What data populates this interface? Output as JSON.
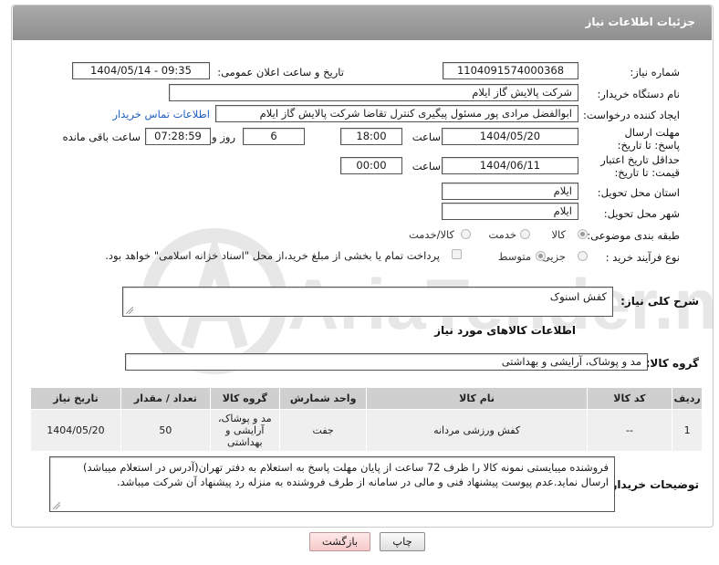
{
  "header": {
    "title": "جزئیات اطلاعات نیاز"
  },
  "fields": {
    "need_number": {
      "label": "شماره نیاز:",
      "value": "1104091574000368"
    },
    "announce": {
      "label": "تاریخ و ساعت اعلان عمومی:",
      "value": "1404/05/14 - 09:35"
    },
    "buyer_org": {
      "label": "نام دستگاه خریدار:",
      "value": "شرکت پالایش گاز ایلام"
    },
    "requester": {
      "label": "ایجاد کننده درخواست:",
      "value": "ابوالفضل مرادی پور مسئول پیگیری کنترل تقاضا شرکت پالایش گاز ایلام",
      "contact_link": "اطلاعات تماس خریدار"
    },
    "deadline": {
      "label": "مهلت ارسال پاسخ: تا تاریخ:",
      "date": "1404/05/20",
      "time_label": "ساعت",
      "time": "18:00",
      "days": "6",
      "days_label": "روز و",
      "remaining": "07:28:59",
      "remaining_label": "ساعت باقی مانده"
    },
    "price_validity": {
      "label": "حداقل تاریخ اعتبار قیمت: تا تاریخ:",
      "date": "1404/06/11",
      "time_label": "ساعت",
      "time": "00:00"
    },
    "province": {
      "label": "استان محل تحویل:",
      "value": "ایلام"
    },
    "city": {
      "label": "شهر محل تحویل:",
      "value": "ایلام"
    },
    "category": {
      "label": "طبقه بندی موضوعی:",
      "options": [
        "کالا",
        "خدمت",
        "کالا/خدمت"
      ],
      "selected": "کالا"
    },
    "process": {
      "label": "نوع فرآیند خرید :",
      "options": [
        "جزیی",
        "متوسط"
      ],
      "selected": "متوسط",
      "note": "پرداخت تمام یا بخشی از مبلغ خرید،از محل \"اسناد خزانه اسلامی\" خواهد بود."
    }
  },
  "description": {
    "label": "شرح کلی نیاز:",
    "value": "کفش اسنوک"
  },
  "goods_section": {
    "title": "اطلاعات کالاهای مورد نیاز"
  },
  "goods_group": {
    "label": "گروه کالا:",
    "value": "مد و پوشاک، آرایشی و بهداشتی"
  },
  "table": {
    "columns": [
      "ردیف",
      "کد کالا",
      "نام کالا",
      "واحد شمارش",
      "گروه کالا",
      "تعداد / مقدار",
      "تاریخ نیاز"
    ],
    "rows": [
      [
        "1",
        "--",
        "کفش ورزشی مردانه",
        "جفت",
        "مد و پوشاک، آرایشی و بهداشتی",
        "50",
        "1404/05/20"
      ]
    ]
  },
  "buyer_notes": {
    "label": "توضیحات خریدار:",
    "value": "فروشنده میبایستی نمونه کالا را ظرف 72 ساعت از پایان مهلت پاسخ به استعلام به دفتر تهران(آدرس در استعلام میباشد) ارسال نماید.عدم پیوست پیشنهاد فنی و مالی  در سامانه از طرف فروشنده به منزله رد پیشنهاد آن شرکت میباشد."
  },
  "buttons": {
    "print": "چاپ",
    "back": "بازگشت"
  },
  "watermark": {
    "text": "AriaTender.neT"
  },
  "colors": {
    "header": "#9c9c9c",
    "link": "#1f5fbf",
    "back_button": "#f6c9c9"
  }
}
